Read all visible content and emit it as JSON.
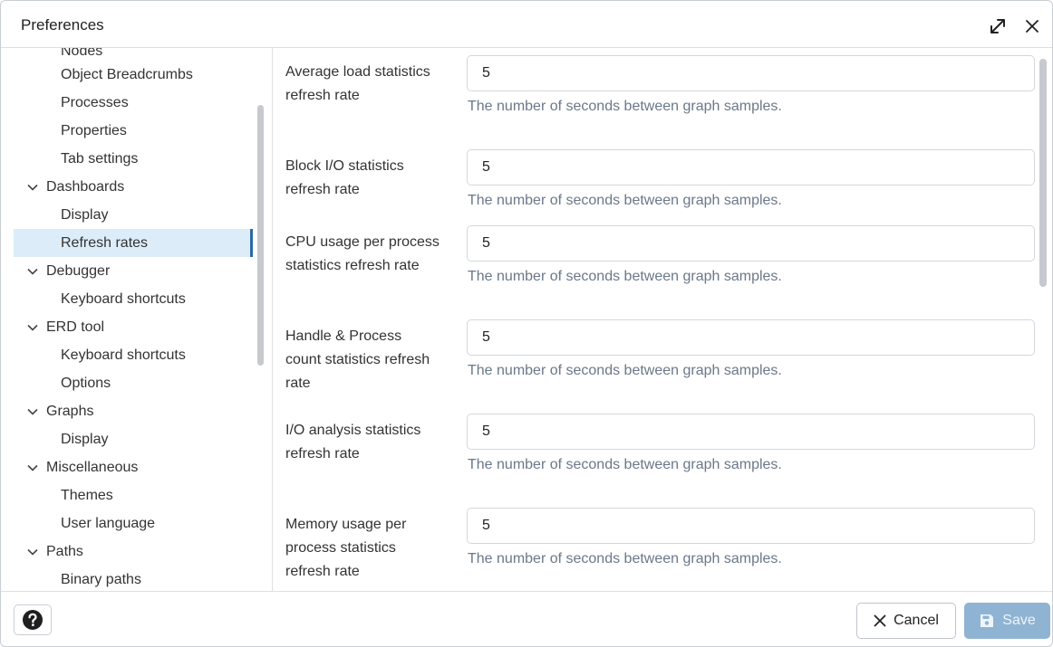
{
  "dialog": {
    "title": "Preferences"
  },
  "sidebar": {
    "items": [
      {
        "label": "Nodes",
        "type": "child",
        "state": "cut"
      },
      {
        "label": "Object Breadcrumbs",
        "type": "child"
      },
      {
        "label": "Processes",
        "type": "child"
      },
      {
        "label": "Properties",
        "type": "child"
      },
      {
        "label": "Tab settings",
        "type": "child"
      },
      {
        "label": "Dashboards",
        "type": "group"
      },
      {
        "label": "Display",
        "type": "child"
      },
      {
        "label": "Refresh rates",
        "type": "child",
        "state": "selected"
      },
      {
        "label": "Debugger",
        "type": "group"
      },
      {
        "label": "Keyboard shortcuts",
        "type": "child"
      },
      {
        "label": "ERD tool",
        "type": "group"
      },
      {
        "label": "Keyboard shortcuts",
        "type": "child"
      },
      {
        "label": "Options",
        "type": "child"
      },
      {
        "label": "Graphs",
        "type": "group"
      },
      {
        "label": "Display",
        "type": "child"
      },
      {
        "label": "Miscellaneous",
        "type": "group"
      },
      {
        "label": "Themes",
        "type": "child"
      },
      {
        "label": "User language",
        "type": "child"
      },
      {
        "label": "Paths",
        "type": "group"
      },
      {
        "label": "Binary paths",
        "type": "child"
      }
    ]
  },
  "fields": [
    {
      "label": "Average load statistics refresh rate",
      "value": "5",
      "help": "The number of seconds between graph samples."
    },
    {
      "label": "Block I/O statistics refresh rate",
      "value": "5",
      "help": "The number of seconds between graph samples."
    },
    {
      "label": "CPU usage per process statistics refresh rate",
      "value": "5",
      "help": "The number of seconds between graph samples."
    },
    {
      "label": "Handle & Process count statistics refresh rate",
      "value": "5",
      "help": "The number of seconds between graph samples."
    },
    {
      "label": "I/O analysis statistics refresh rate",
      "value": "5",
      "help": "The number of seconds between graph samples."
    },
    {
      "label": "Memory usage per process statistics refresh rate",
      "value": "5",
      "help": "The number of seconds between graph samples."
    }
  ],
  "footer": {
    "cancel_label": "Cancel",
    "save_label": "Save"
  },
  "icons": {
    "expand": "expand-icon",
    "close": "close-icon",
    "chevron": "chevron-down-icon",
    "help": "question-circle-icon",
    "cancel": "x-icon",
    "save": "floppy-disk-icon"
  },
  "colors": {
    "selected_bg": "#dcecf8",
    "selected_bar": "#2a6aa3",
    "help_text": "#6b7889",
    "save_bg": "#8fb3d3"
  }
}
